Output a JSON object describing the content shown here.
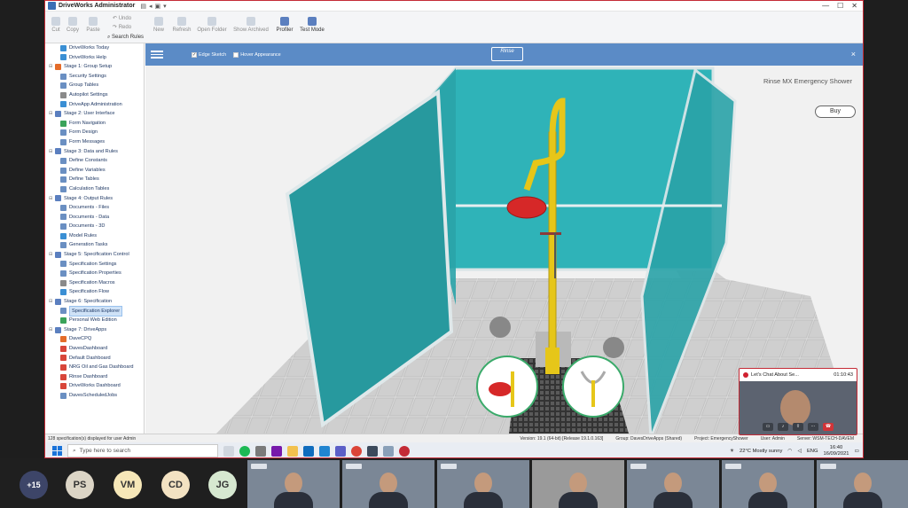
{
  "window": {
    "title": "DriveWorks Administrator",
    "buttons": [
      "—",
      "☐",
      "✕"
    ]
  },
  "ribbon": {
    "left_buttons": [
      "Cut",
      "Copy",
      "Paste"
    ],
    "undo": "Undo",
    "redo": "Redo",
    "search_rules": "Search Rules",
    "buttons": [
      "New",
      "Refresh",
      "Open Folder",
      "Show Archived",
      "Profiler",
      "Test Mode"
    ]
  },
  "sidebar": {
    "items": [
      {
        "label": "DriveWorks Today",
        "stage": false,
        "selected": false,
        "color": "#3a8fd4"
      },
      {
        "label": "DriveWorks Help",
        "stage": false,
        "selected": false,
        "color": "#3a8fd4"
      },
      {
        "label": "Stage 1: Group Setup",
        "stage": true,
        "selected": false,
        "color": "#e46c2a"
      },
      {
        "label": "Security Settings",
        "stage": false,
        "selected": false,
        "color": "#6a8fc2"
      },
      {
        "label": "Group Tables",
        "stage": false,
        "selected": false,
        "color": "#6a8fc2"
      },
      {
        "label": "Autopilot Settings",
        "stage": false,
        "selected": false,
        "color": "#8a8a8a"
      },
      {
        "label": "DriveApp Administration",
        "stage": false,
        "selected": false,
        "color": "#3a8fd4"
      },
      {
        "label": "Stage 2: User Interface",
        "stage": true,
        "selected": false,
        "color": "#5b7fbf"
      },
      {
        "label": "Form Navigation",
        "stage": false,
        "selected": false,
        "color": "#3aa35a"
      },
      {
        "label": "Form Design",
        "stage": false,
        "selected": false,
        "color": "#6a8fc2"
      },
      {
        "label": "Form Messages",
        "stage": false,
        "selected": false,
        "color": "#6a8fc2"
      },
      {
        "label": "Stage 3: Data and Rules",
        "stage": true,
        "selected": false,
        "color": "#5b7fbf"
      },
      {
        "label": "Define Constants",
        "stage": false,
        "selected": false,
        "color": "#6a8fc2"
      },
      {
        "label": "Define Variables",
        "stage": false,
        "selected": false,
        "color": "#6a8fc2"
      },
      {
        "label": "Define Tables",
        "stage": false,
        "selected": false,
        "color": "#6a8fc2"
      },
      {
        "label": "Calculation Tables",
        "stage": false,
        "selected": false,
        "color": "#6a8fc2"
      },
      {
        "label": "Stage 4: Output Rules",
        "stage": true,
        "selected": false,
        "color": "#5b7fbf"
      },
      {
        "label": "Documents - Files",
        "stage": false,
        "selected": false,
        "color": "#6a8fc2"
      },
      {
        "label": "Documents - Data",
        "stage": false,
        "selected": false,
        "color": "#6a8fc2"
      },
      {
        "label": "Documents - 3D",
        "stage": false,
        "selected": false,
        "color": "#6a8fc2"
      },
      {
        "label": "Model Rules",
        "stage": false,
        "selected": false,
        "color": "#3a8fd4"
      },
      {
        "label": "Generation Tasks",
        "stage": false,
        "selected": false,
        "color": "#6a8fc2"
      },
      {
        "label": "Stage 5: Specification Control",
        "stage": true,
        "selected": false,
        "color": "#5b7fbf"
      },
      {
        "label": "Specification Settings",
        "stage": false,
        "selected": false,
        "color": "#6a8fc2"
      },
      {
        "label": "Specification Properties",
        "stage": false,
        "selected": false,
        "color": "#6a8fc2"
      },
      {
        "label": "Specification Macros",
        "stage": false,
        "selected": false,
        "color": "#8a8a8a"
      },
      {
        "label": "Specification Flow",
        "stage": false,
        "selected": false,
        "color": "#3a8fd4"
      },
      {
        "label": "Stage 6: Specification",
        "stage": true,
        "selected": false,
        "color": "#5b7fbf"
      },
      {
        "label": "Specification Explorer",
        "stage": false,
        "selected": true,
        "color": "#6a8fc2"
      },
      {
        "label": "Personal Web Edition",
        "stage": false,
        "selected": false,
        "color": "#3aa35a"
      },
      {
        "label": "Stage 7: DriveApps",
        "stage": true,
        "selected": false,
        "color": "#5b7fbf"
      },
      {
        "label": "DaveCPQ",
        "stage": false,
        "selected": false,
        "color": "#e46c2a"
      },
      {
        "label": "DavesDashboard",
        "stage": false,
        "selected": false,
        "color": "#d8463a"
      },
      {
        "label": "Default Dashboard",
        "stage": false,
        "selected": false,
        "color": "#d8463a"
      },
      {
        "label": "NRG Oil and Gas Dashboard",
        "stage": false,
        "selected": false,
        "color": "#d8463a"
      },
      {
        "label": "Rinse Dashboard",
        "stage": false,
        "selected": false,
        "color": "#d8463a"
      },
      {
        "label": "DriveWorks Dashboard",
        "stage": false,
        "selected": false,
        "color": "#d8463a"
      },
      {
        "label": "DavesScheduledJobs",
        "stage": false,
        "selected": false,
        "color": "#6a8fc2"
      }
    ]
  },
  "viewer": {
    "edge_sketch_label": "Edge Sketch",
    "hover_label": "Hover Appearance",
    "logo_text": "Rinse",
    "close": "×",
    "product_title": "Rinse MX Emergency Shower",
    "buy_label": "Buy",
    "accent_color": "#5b8bc6"
  },
  "status": {
    "left": "128 specification(s) displayed for user Admin",
    "version": "Version: 19.1 (64-bit) [Release 19.1.0.163]",
    "group": "Group: DavesDriveApps (Shared)",
    "project": "Project: EmergencyShower",
    "user": "User: Admin",
    "server": "Server: WSM-TECH-DAVEM"
  },
  "taskbar": {
    "search_placeholder": "Type here to search",
    "weather": "22°C  Mostly sunny",
    "lang": "ENG",
    "time": "16:40",
    "date": "16/09/2021"
  },
  "chat": {
    "title": "Let's Chat About Se...",
    "time": "01:10:43"
  },
  "meeting": {
    "more": "+15",
    "participants": [
      {
        "initials": "PS",
        "bg": "#dcd5c6"
      },
      {
        "initials": "VM",
        "bg": "#f6e7b8"
      },
      {
        "initials": "CD",
        "bg": "#f3e2c2"
      },
      {
        "initials": "JG",
        "bg": "#d6e8d0"
      }
    ]
  }
}
